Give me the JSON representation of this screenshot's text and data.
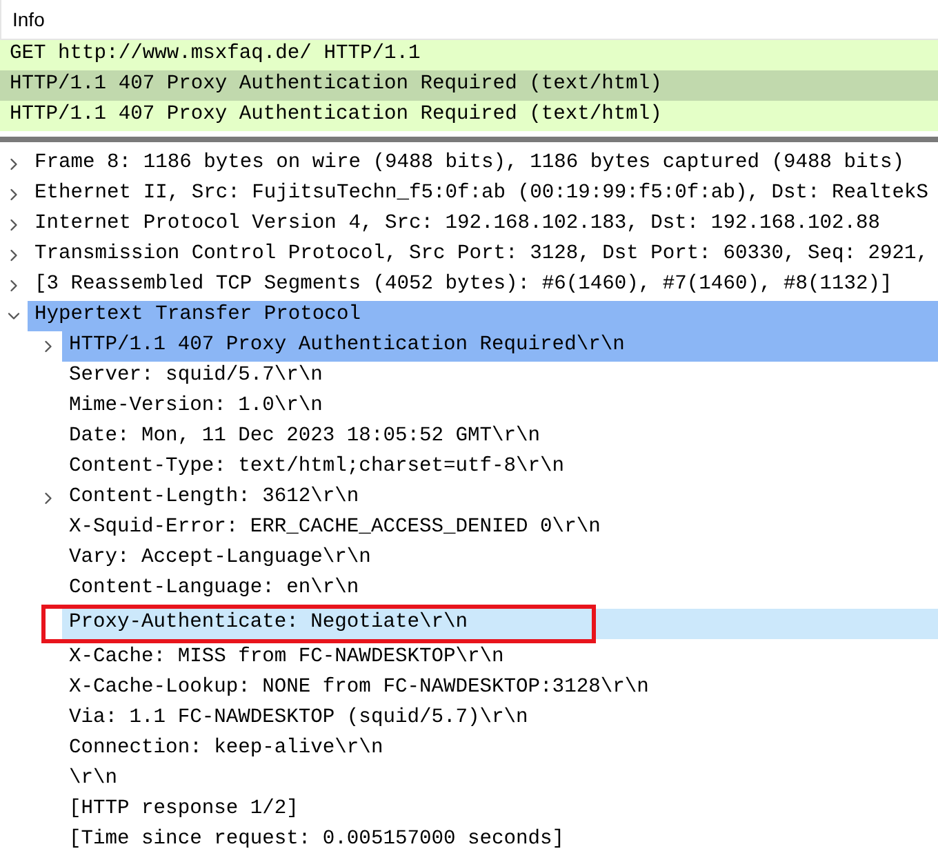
{
  "packet_list": {
    "columns": [
      "Info"
    ],
    "rows": [
      {
        "info": "GET http://www.msxfaq.de/ HTTP/1.1",
        "selected": false
      },
      {
        "info": "HTTP/1.1 407 Proxy Authentication Required  (text/html)",
        "selected": true
      },
      {
        "info": "HTTP/1.1 407 Proxy Authentication Required  (text/html)",
        "selected": false
      }
    ]
  },
  "details": [
    {
      "text": "Frame 8: 1186 bytes on wire (9488 bits), 1186 bytes captured (9488 bits)",
      "expanded": false,
      "selected": false
    },
    {
      "text": "Ethernet II, Src: FujitsuTechn_f5:0f:ab (00:19:99:f5:0f:ab), Dst: RealtekS",
      "expanded": false,
      "selected": false
    },
    {
      "text": "Internet Protocol Version 4, Src: 192.168.102.183, Dst: 192.168.102.88",
      "expanded": false,
      "selected": false
    },
    {
      "text": "Transmission Control Protocol, Src Port: 3128, Dst Port: 60330, Seq: 2921,",
      "expanded": false,
      "selected": false
    },
    {
      "text": "[3 Reassembled TCP Segments (4052 bytes): #6(1460), #7(1460), #8(1132)]",
      "expanded": false,
      "selected": false
    },
    {
      "text": "Hypertext Transfer Protocol",
      "expanded": true,
      "selected": true,
      "children": [
        {
          "text": "HTTP/1.1 407 Proxy Authentication Required\\r\\n",
          "expanded": false,
          "selected": true
        },
        {
          "text": "Server: squid/5.7\\r\\n",
          "selected": false
        },
        {
          "text": "Mime-Version: 1.0\\r\\n",
          "selected": false
        },
        {
          "text": "Date: Mon, 11 Dec 2023 18:05:52 GMT\\r\\n",
          "selected": false
        },
        {
          "text": "Content-Type: text/html;charset=utf-8\\r\\n",
          "selected": false
        },
        {
          "text": "Content-Length: 3612\\r\\n",
          "expanded": false,
          "selected": false
        },
        {
          "text": "X-Squid-Error: ERR_CACHE_ACCESS_DENIED 0\\r\\n",
          "selected": false
        },
        {
          "text": "Vary: Accept-Language\\r\\n",
          "selected": false
        },
        {
          "text": "Content-Language: en\\r\\n",
          "selected": false
        },
        {
          "text": "Proxy-Authenticate: Negotiate\\r\\n",
          "selected": false,
          "highlighted": true
        },
        {
          "text": "X-Cache: MISS from FC-NAWDESKTOP\\r\\n",
          "selected": false
        },
        {
          "text": "X-Cache-Lookup: NONE from FC-NAWDESKTOP:3128\\r\\n",
          "selected": false
        },
        {
          "text": "Via: 1.1 FC-NAWDESKTOP (squid/5.7)\\r\\n",
          "selected": false
        },
        {
          "text": "Connection: keep-alive\\r\\n",
          "selected": false
        },
        {
          "text": "\\r\\n",
          "selected": false
        },
        {
          "text": "[HTTP response 1/2]",
          "selected": false
        },
        {
          "text": "[Time since request: 0.005157000 seconds]",
          "selected": false
        }
      ]
    }
  ]
}
